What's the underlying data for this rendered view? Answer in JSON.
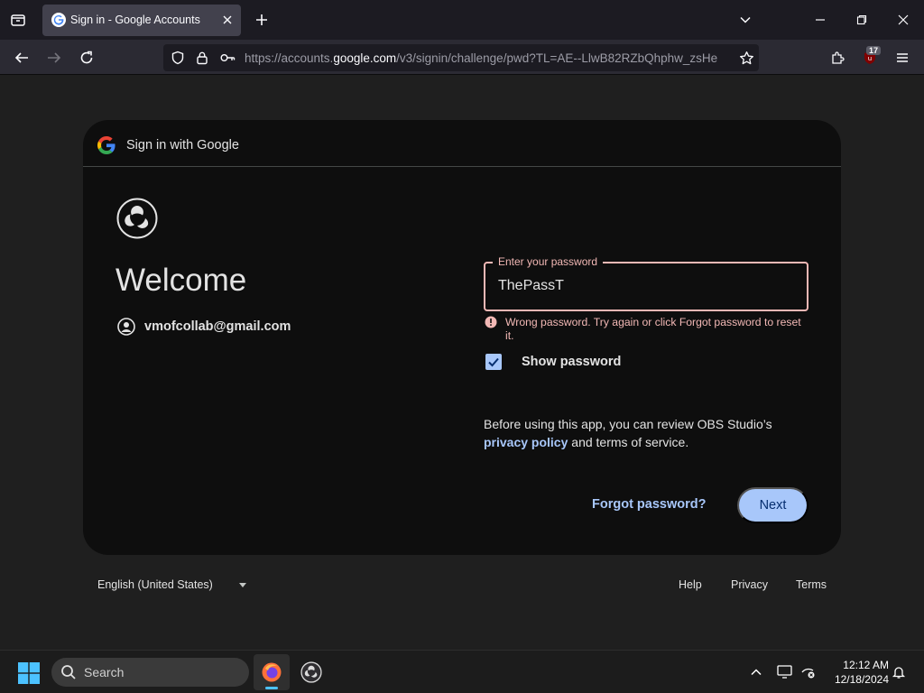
{
  "browser": {
    "tab": {
      "title": "Sign in - Google Accounts"
    },
    "url": {
      "prefix": "https://accounts.",
      "domain": "google.com",
      "suffix": "/v3/signin/challenge/pwd?TL=AE--LlwB82RZbQhphw_zsHe"
    },
    "extension_badge": "17"
  },
  "page": {
    "header": "Sign in with Google",
    "welcome": "Welcome",
    "email": "vmofcollab@gmail.com",
    "password": {
      "label": "Enter your password",
      "value": "ThePassT",
      "error": "Wrong password. Try again or click Forgot password to reset it."
    },
    "show_password": {
      "label": "Show password",
      "checked": true
    },
    "consent": {
      "before": "Before using this app, you can review OBS Studio’s",
      "privacy_link": "privacy policy",
      "after": "and terms of service."
    },
    "forgot_password": "Forgot password?",
    "next": "Next",
    "footer": {
      "language": "English (United States)",
      "help": "Help",
      "privacy": "Privacy",
      "terms": "Terms"
    }
  },
  "taskbar": {
    "search_label": "Search",
    "time": "12:12 AM",
    "date": "12/18/2024"
  },
  "colors": {
    "accent": "#a8c7fa",
    "error": "#f2b8b5",
    "card_background": "#0e0e0e",
    "page_background": "#1f1f1f"
  }
}
